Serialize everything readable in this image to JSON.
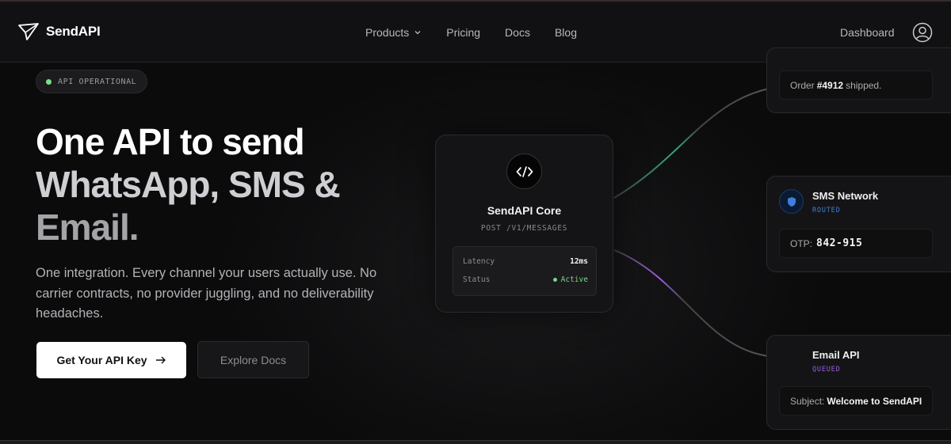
{
  "nav": {
    "brand": "SendAPI",
    "links": [
      {
        "label": "Products",
        "has_dropdown": true
      },
      {
        "label": "Pricing"
      },
      {
        "label": "Docs"
      },
      {
        "label": "Blog"
      }
    ],
    "dashboard": "Dashboard"
  },
  "hero": {
    "status": "API OPERATIONAL",
    "headline_line1": "One API to send",
    "headline_line2": "WhatsApp, SMS &",
    "headline_line3": "Email.",
    "subtext": "One integration. Every channel your users actually use. No carrier contracts, no provider juggling, and no deliverability headaches.",
    "primary_cta": "Get Your API Key",
    "secondary_cta": "Explore Docs"
  },
  "core": {
    "title": "SendAPI Core",
    "endpoint": "POST /V1/MESSAGES",
    "latency_label": "Latency",
    "latency_value": "12ms",
    "status_label": "Status",
    "status_value": "Active"
  },
  "cards": {
    "order": {
      "prefix": "Order",
      "number": "#4912",
      "suffix": "shipped."
    },
    "sms": {
      "title": "SMS Network",
      "status": "ROUTED",
      "otp_label": "OTP:",
      "otp_value": "842-915"
    },
    "email": {
      "title": "Email API",
      "status": "QUEUED",
      "subject_label": "Subject:",
      "subject_value": "Welcome to SendAPI"
    }
  },
  "colors": {
    "status_green": "#79e08a",
    "routed_blue": "#3f7fd9",
    "queued_purple": "#9b5ee0",
    "background": "#0b0b0c"
  },
  "icons": [
    "paper-plane-icon",
    "chevron-down-icon",
    "user-icon",
    "arrow-right-icon",
    "code-icon",
    "shield-icon"
  ]
}
